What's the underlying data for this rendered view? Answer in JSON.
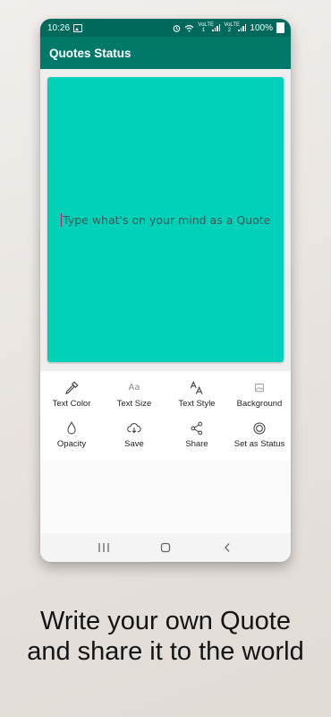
{
  "status_bar": {
    "time": "10:26",
    "signal_text_1": "VoLTE 1",
    "signal_text_2": "VoLTE 2",
    "battery": "100%"
  },
  "app": {
    "title": "Quotes Status"
  },
  "editor": {
    "placeholder": "Type what's on your mind as a Quote",
    "background_color": "#00d1b8"
  },
  "toolbar": {
    "text_color": "Text Color",
    "text_size": "Text Size",
    "text_size_icon": "Aa",
    "text_style": "Text Style",
    "background": "Background",
    "opacity": "Opacity",
    "save": "Save",
    "share": "Share",
    "set_as_status": "Set as Status"
  },
  "caption": {
    "line1": "Write your own Quote",
    "line2": "and share it to the world"
  },
  "colors": {
    "status_bar": "#00695c",
    "app_bar": "#00796b",
    "accent": "#00d1b8"
  }
}
